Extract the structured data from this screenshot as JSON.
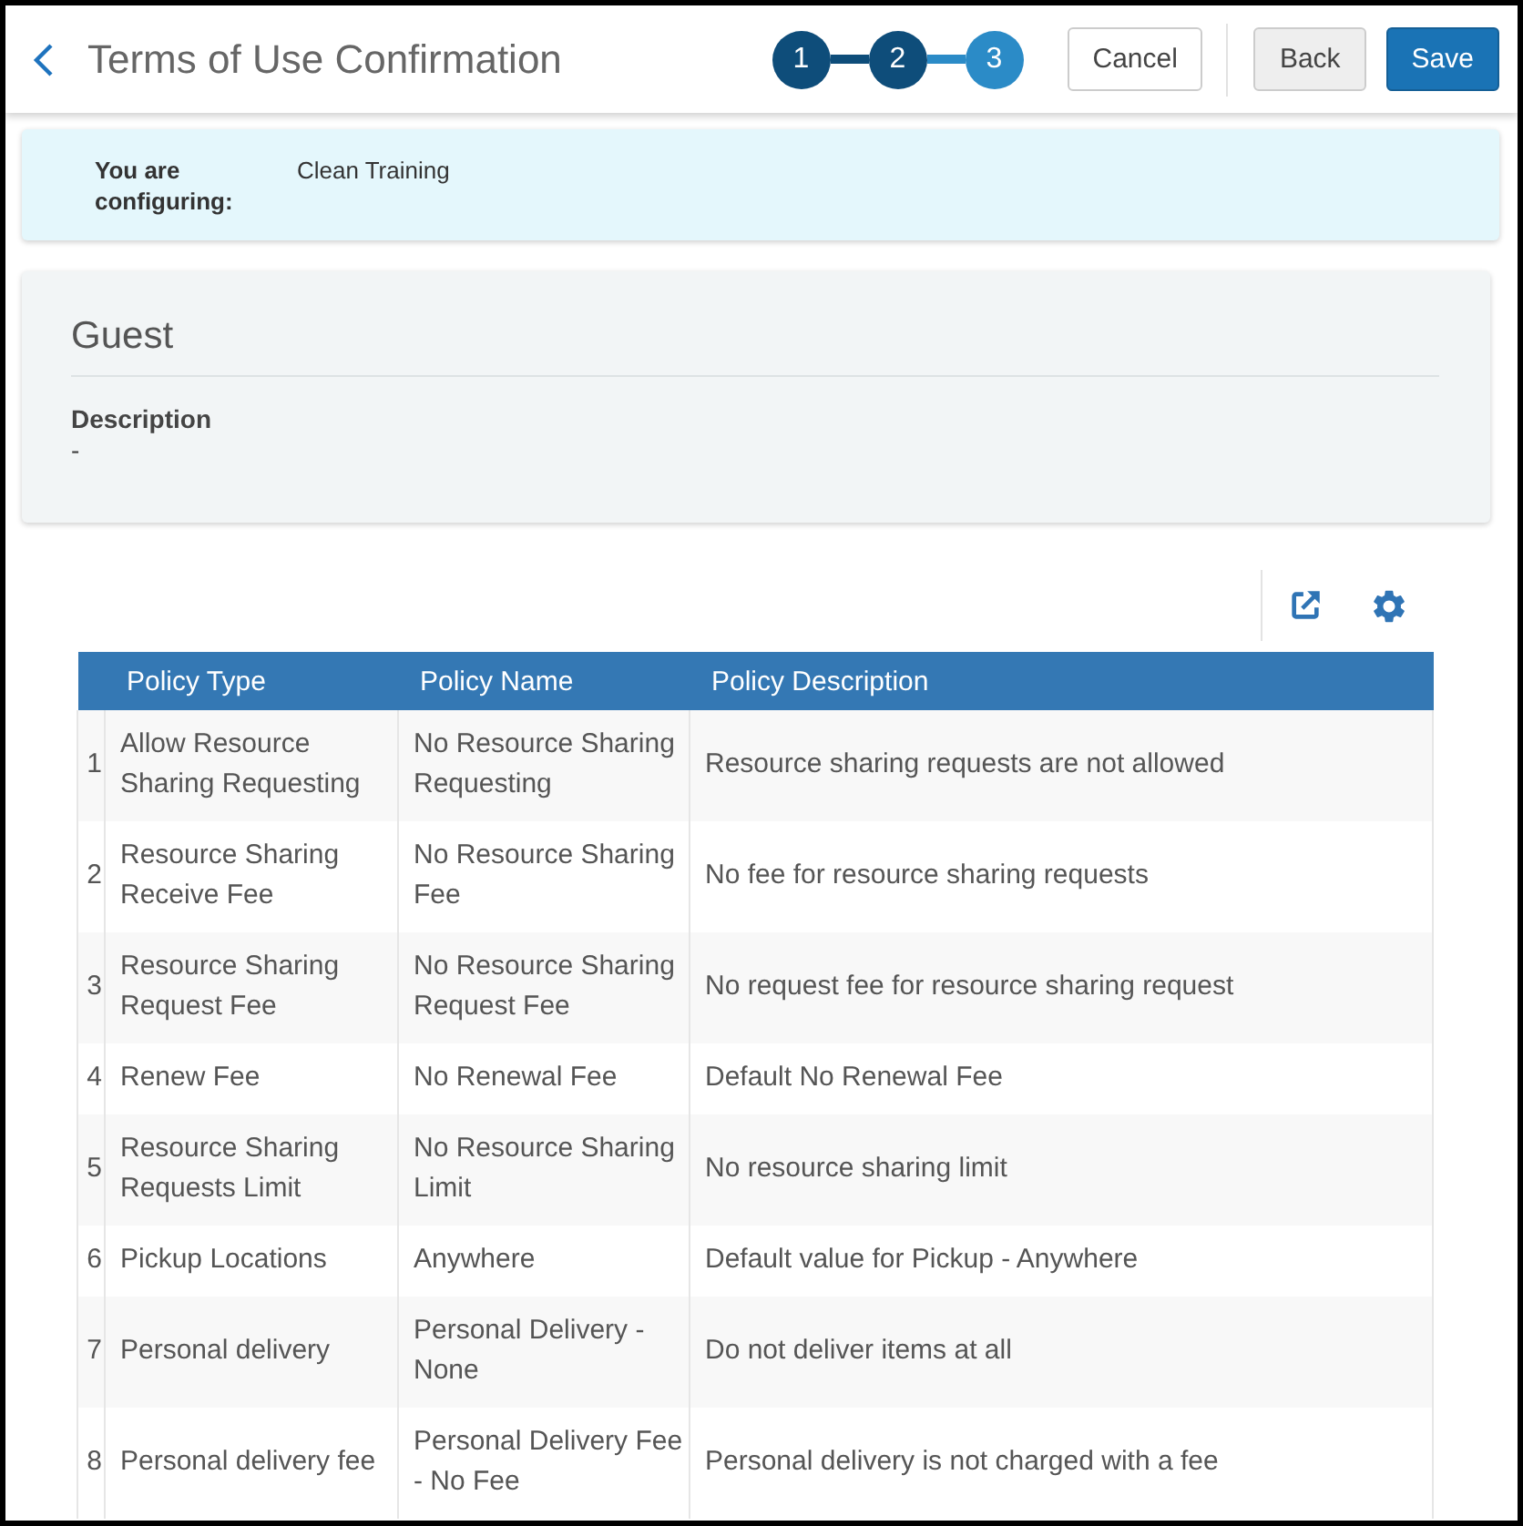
{
  "header": {
    "title": "Terms of Use Confirmation",
    "steps": [
      {
        "label": "1",
        "current": false
      },
      {
        "label": "2",
        "current": false
      },
      {
        "label": "3",
        "current": true
      }
    ],
    "buttons": [
      {
        "label": "Cancel",
        "kind": "outline"
      },
      {
        "label": "Back",
        "kind": "secondary"
      },
      {
        "label": "Save",
        "kind": "primary"
      }
    ]
  },
  "context": {
    "label": "You are configuring:",
    "value": "Clean Training"
  },
  "card": {
    "title": "Guest",
    "fields": [
      {
        "label": "Description",
        "value": "-"
      }
    ]
  },
  "table": {
    "columns": [
      "Policy Type",
      "Policy Name",
      "Policy Description"
    ],
    "rows": [
      {
        "number": "1",
        "cells": [
          "Allow Resource Sharing Requesting",
          "No Resource Sharing Requesting",
          "Resource sharing requests are not allowed"
        ]
      },
      {
        "number": "2",
        "cells": [
          "Resource Sharing Receive Fee",
          "No Resource Sharing Fee",
          "No fee for resource sharing requests"
        ]
      },
      {
        "number": "3",
        "cells": [
          "Resource Sharing Request Fee",
          "No Resource Sharing Request Fee",
          "No request fee for resource sharing request"
        ]
      },
      {
        "number": "4",
        "cells": [
          "Renew Fee",
          "No Renewal Fee",
          "Default No Renewal Fee"
        ]
      },
      {
        "number": "5",
        "cells": [
          "Resource Sharing Requests Limit",
          "No Resource Sharing Limit",
          "No resource sharing limit"
        ]
      },
      {
        "number": "6",
        "cells": [
          "Pickup Locations",
          "Anywhere",
          "Default value for Pickup - Anywhere"
        ]
      },
      {
        "number": "7",
        "cells": [
          "Personal delivery",
          "Personal Delivery - None",
          "Do not deliver items at all"
        ]
      },
      {
        "number": "8",
        "cells": [
          "Personal delivery fee",
          "Personal Delivery Fee - No Fee",
          "Personal delivery is not charged with a fee"
        ]
      }
    ]
  }
}
